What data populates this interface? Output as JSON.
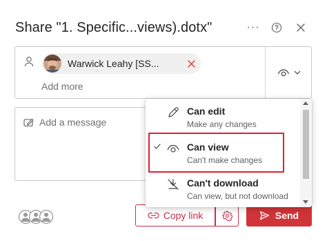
{
  "dialog": {
    "title": "Share \"1. Specific...views).dotx\"",
    "more_icon": "more-horizontal-icon",
    "help_icon": "help-circle-icon",
    "close_icon": "close-icon"
  },
  "recipients": {
    "person_icon": "person-icon",
    "chips": [
      {
        "name": "Warwick Leahy [SS...",
        "avatar": "avatar-photo",
        "remove_icon": "dismiss-icon"
      }
    ],
    "add_more": "Add more",
    "permission_icon": "eye-icon"
  },
  "message": {
    "placeholder": "Add a message",
    "icon": "edit-note-icon"
  },
  "permission_menu": {
    "selected": "Can view",
    "items": [
      {
        "title": "Can edit",
        "description": "Make any changes",
        "icon": "pencil-icon",
        "selected": false
      },
      {
        "title": "Can view",
        "description": "Can't make changes",
        "icon": "eye-icon",
        "selected": true
      },
      {
        "title": "Can't download",
        "description": "Can view, but not download",
        "icon": "no-download-icon",
        "selected": false
      }
    ]
  },
  "footer": {
    "people_icon": "people-group-icon",
    "copy_link_label": "Copy link",
    "copy_link_icon": "link-icon",
    "settings_icon": "gear-icon",
    "send_label": "Send",
    "send_icon": "send-icon"
  },
  "colors": {
    "accent": "#c4314b",
    "send_bg": "#d13438",
    "highlight_border": "#e0202a"
  }
}
